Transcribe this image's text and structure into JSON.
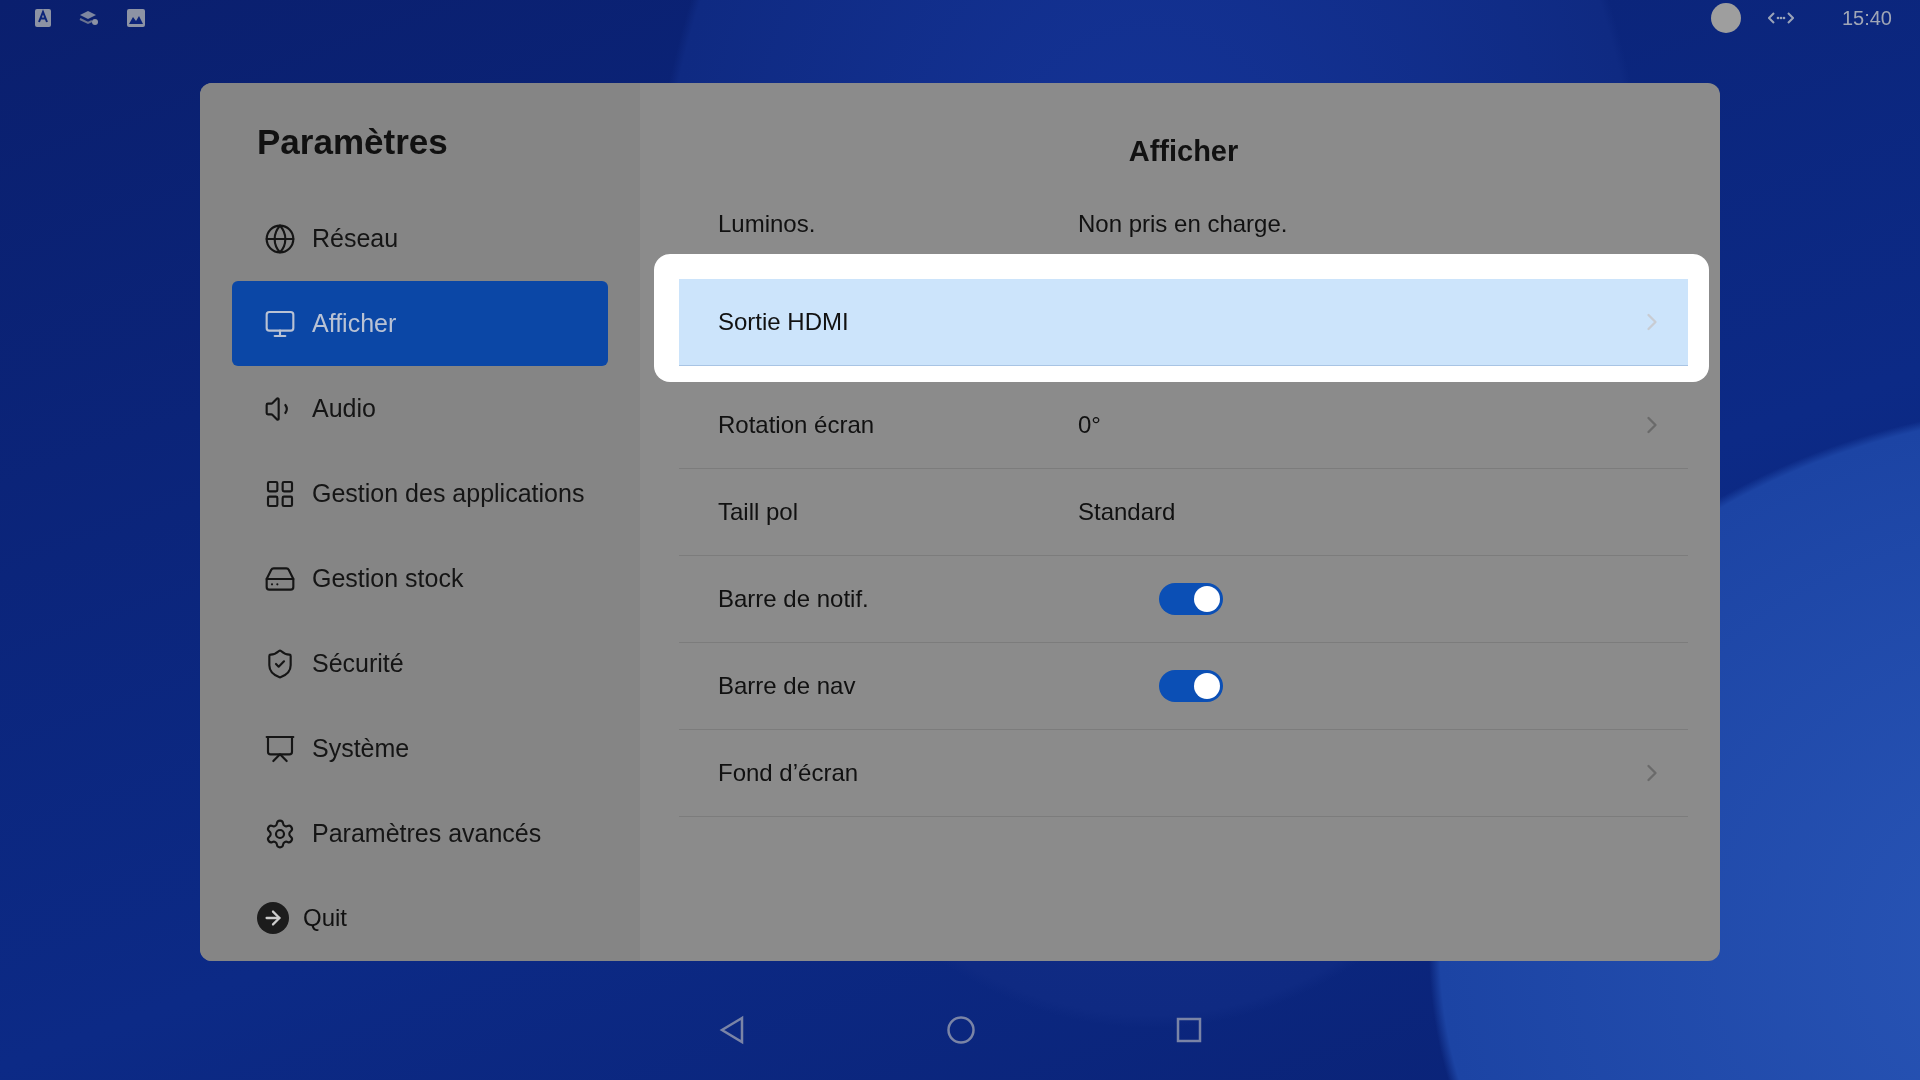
{
  "status_bar": {
    "time": "15:40"
  },
  "sidebar": {
    "title": "Paramètres",
    "items": [
      {
        "label": "Réseau",
        "selected": false
      },
      {
        "label": "Afficher",
        "selected": true
      },
      {
        "label": "Audio",
        "selected": false
      },
      {
        "label": "Gestion des applications",
        "selected": false
      },
      {
        "label": "Gestion stock",
        "selected": false
      },
      {
        "label": "Sécurité",
        "selected": false
      },
      {
        "label": "Système",
        "selected": false
      },
      {
        "label": "Paramètres avancés",
        "selected": false
      }
    ],
    "quit": "Quit"
  },
  "content": {
    "title": "Afficher",
    "rows": [
      {
        "kind": "info",
        "label": "Luminos.",
        "value": "Non pris en charge.",
        "highlighted": false
      },
      {
        "kind": "link",
        "label": "Sortie HDMI",
        "highlighted": true
      },
      {
        "kind": "link",
        "label": "Rotation écran",
        "value": "0°",
        "highlighted": false
      },
      {
        "kind": "info",
        "label": "Taill pol",
        "value": "Standard",
        "highlighted": false
      },
      {
        "kind": "toggle",
        "label": "Barre de notif.",
        "on": true,
        "highlighted": false
      },
      {
        "kind": "toggle",
        "label": "Barre de nav",
        "on": true,
        "highlighted": false
      },
      {
        "kind": "link",
        "label": "Fond d’écran",
        "highlighted": false
      }
    ]
  }
}
